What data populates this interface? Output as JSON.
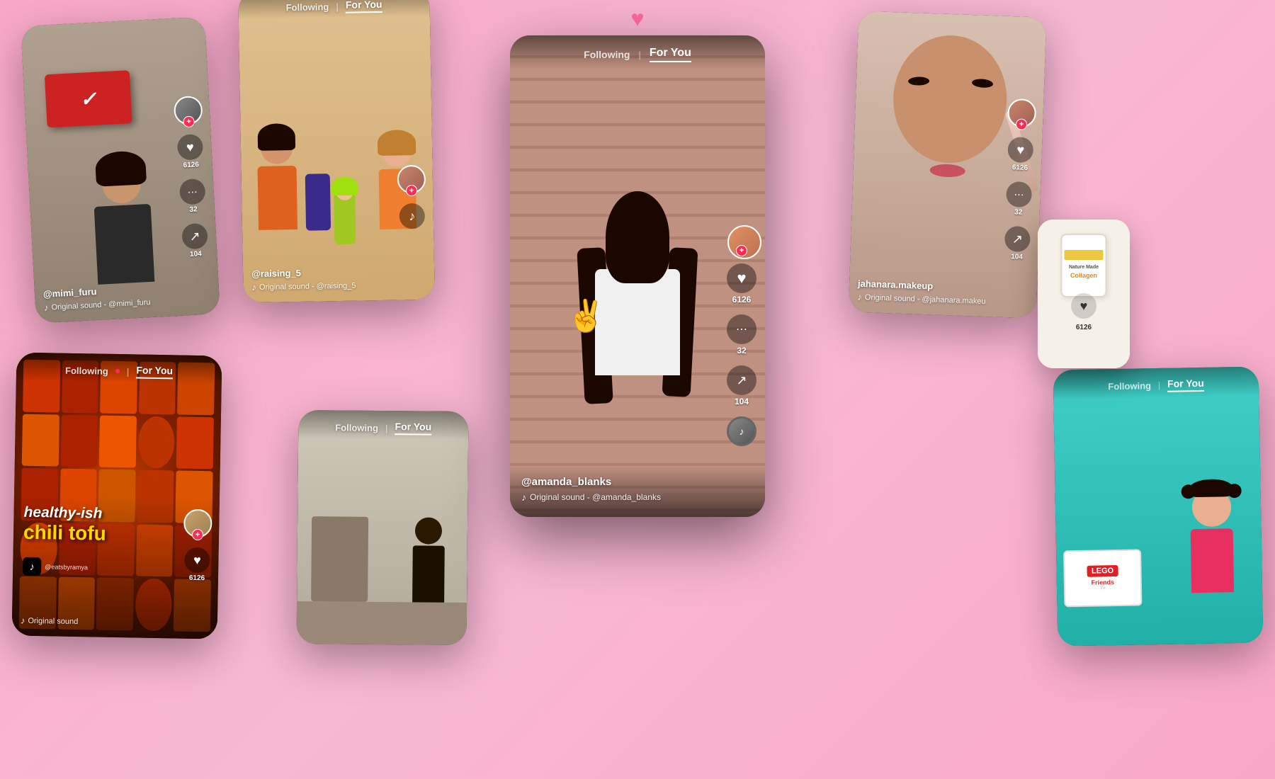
{
  "app": {
    "title": "TikTok",
    "bg_color": "#f9a8c9"
  },
  "nav": {
    "following_label": "Following",
    "for_you_label": "For You",
    "divider": "|"
  },
  "cards": [
    {
      "id": "card1",
      "username": "@mimi_furu",
      "sound": "Original sound - @mimi_furu",
      "likes": "6126",
      "comments": "32",
      "shares": "104",
      "type": "fashion"
    },
    {
      "id": "card2",
      "username": "@raising_5",
      "sound": "Original sound - @raising_5",
      "likes": "",
      "type": "kids",
      "show_nav": true
    },
    {
      "id": "card3",
      "username": "@eatsbyramya",
      "title_line1": "healthy-ish",
      "title_line2": "chili tofu",
      "sound": "Original sound",
      "likes": "6126",
      "type": "food",
      "show_nav": true
    },
    {
      "id": "card4",
      "username": "",
      "type": "interior",
      "show_nav": true
    },
    {
      "id": "card5",
      "username": "@amanda_blanks",
      "sound": "Original sound - @amanda_blanks",
      "likes": "6126",
      "comments": "32",
      "shares": "104",
      "type": "main",
      "show_nav": true
    },
    {
      "id": "card6",
      "username": "jahanara.makeup",
      "sound": "Original sound - @jahanara.makeu",
      "likes": "6126",
      "comments": "32",
      "shares": "104",
      "type": "makeup"
    },
    {
      "id": "card7",
      "username": "",
      "type": "lego",
      "show_nav": true
    },
    {
      "id": "card8",
      "type": "supplement",
      "label": "Collagen",
      "brand": "Nature Made",
      "likes": "6126"
    }
  ],
  "actions": {
    "like_icon": "♥",
    "comment_icon": "⋯",
    "share_icon": "↗",
    "music_icon": "♪",
    "plus_icon": "+"
  }
}
